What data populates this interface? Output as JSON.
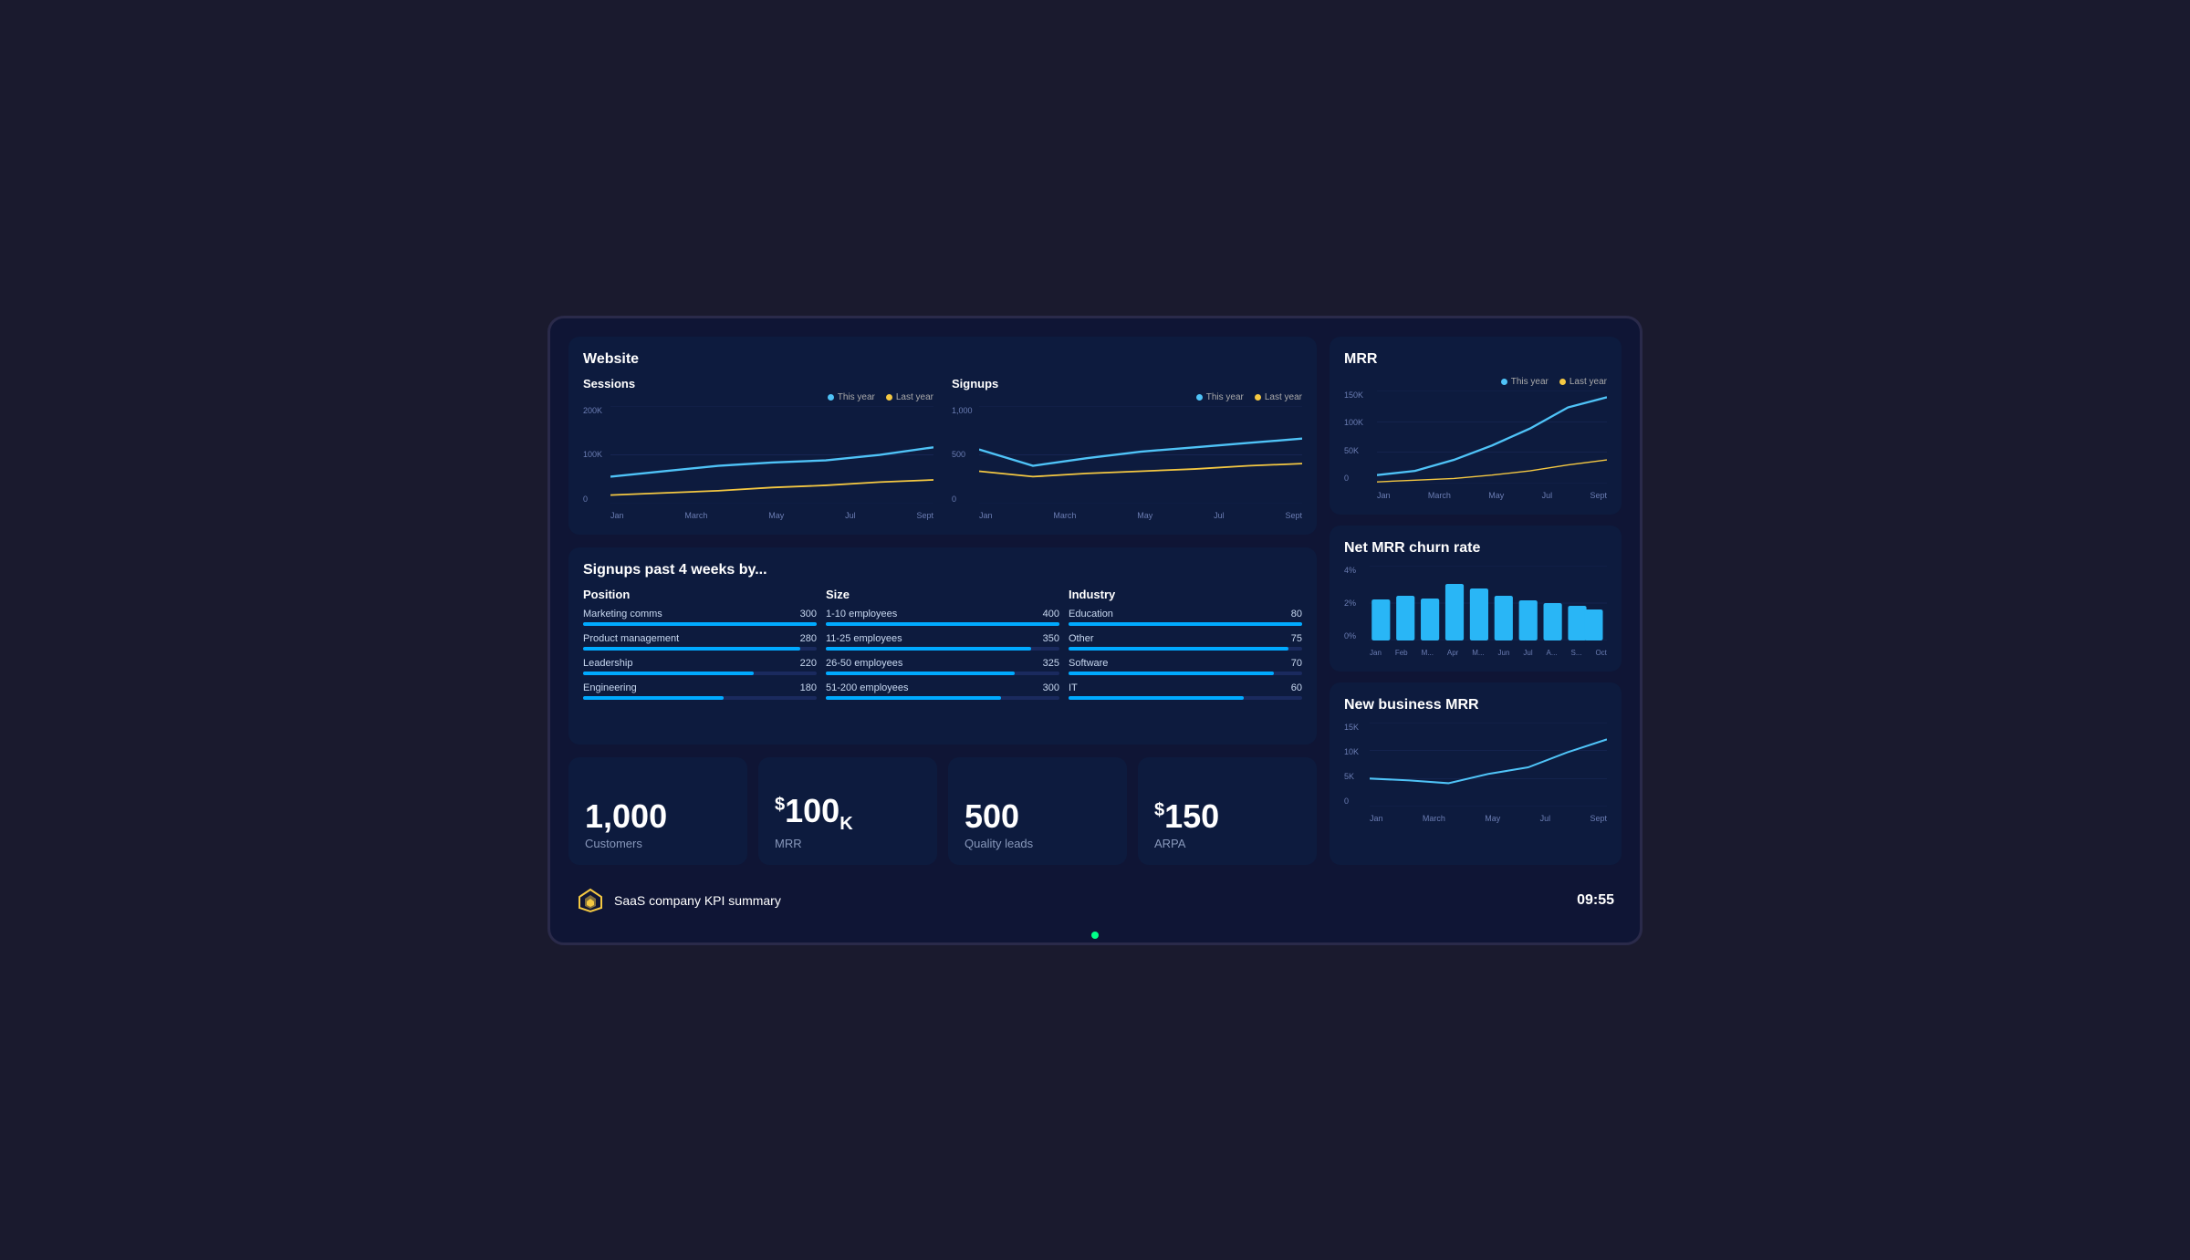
{
  "title": "SaaS company KPI summary",
  "time": "09:55",
  "website": {
    "label": "Website",
    "sessions": {
      "label": "Sessions",
      "y_labels": [
        "200K",
        "100K",
        "0"
      ],
      "x_labels": [
        "Jan",
        "March",
        "May",
        "Jul",
        "Sept"
      ],
      "this_year_label": "This year",
      "last_year_label": "Last year"
    },
    "signups": {
      "label": "Signups",
      "y_labels": [
        "1,000",
        "500",
        "0"
      ],
      "x_labels": [
        "Jan",
        "March",
        "May",
        "Jul",
        "Sept"
      ],
      "this_year_label": "This year",
      "last_year_label": "Last year"
    }
  },
  "signups_past": {
    "title": "Signups past 4 weeks by...",
    "position": {
      "title": "Position",
      "rows": [
        {
          "label": "Marketing comms",
          "value": "300",
          "pct": 100
        },
        {
          "label": "Product management",
          "value": "280",
          "pct": 93
        },
        {
          "label": "Leadership",
          "value": "220",
          "pct": 73
        },
        {
          "label": "Engineering",
          "value": "180",
          "pct": 60
        }
      ]
    },
    "size": {
      "title": "Size",
      "rows": [
        {
          "label": "1-10 employees",
          "value": "400",
          "pct": 100
        },
        {
          "label": "11-25 employees",
          "value": "350",
          "pct": 88
        },
        {
          "label": "26-50 employees",
          "value": "325",
          "pct": 81
        },
        {
          "label": "51-200 employees",
          "value": "300",
          "pct": 75
        }
      ]
    },
    "industry": {
      "title": "Industry",
      "rows": [
        {
          "label": "Education",
          "value": "80",
          "pct": 100
        },
        {
          "label": "Other",
          "value": "75",
          "pct": 94
        },
        {
          "label": "Software",
          "value": "70",
          "pct": 88
        },
        {
          "label": "IT",
          "value": "60",
          "pct": 75
        }
      ]
    }
  },
  "kpis": [
    {
      "number": "1,000",
      "prefix": "",
      "suffix": "",
      "desc": "Customers"
    },
    {
      "number": "100",
      "prefix": "$",
      "suffix": "K",
      "desc": "MRR"
    },
    {
      "number": "500",
      "prefix": "",
      "suffix": "",
      "desc": "Quality leads"
    },
    {
      "number": "150",
      "prefix": "$",
      "suffix": "",
      "desc": "ARPA"
    }
  ],
  "mrr": {
    "title": "MRR",
    "y_labels": [
      "150K",
      "100K",
      "50K",
      "0"
    ],
    "x_labels": [
      "Jan",
      "March",
      "May",
      "Jul",
      "Sept"
    ],
    "this_year_label": "This year",
    "last_year_label": "Last year"
  },
  "net_mrr": {
    "title": "Net MRR churn rate",
    "y_labels": [
      "4%",
      "2%",
      "0%"
    ],
    "x_labels": [
      "Jan",
      "Feb",
      "M...",
      "Apr",
      "M...",
      "Jun",
      "Jul",
      "A...",
      "S...",
      "Oct"
    ],
    "bars": [
      55,
      60,
      50,
      75,
      70,
      60,
      55,
      50,
      45,
      40
    ]
  },
  "new_business": {
    "title": "New business MRR",
    "y_labels": [
      "15K",
      "10K",
      "5K",
      "0"
    ],
    "x_labels": [
      "Jan",
      "March",
      "May",
      "Jul",
      "Sept"
    ]
  }
}
